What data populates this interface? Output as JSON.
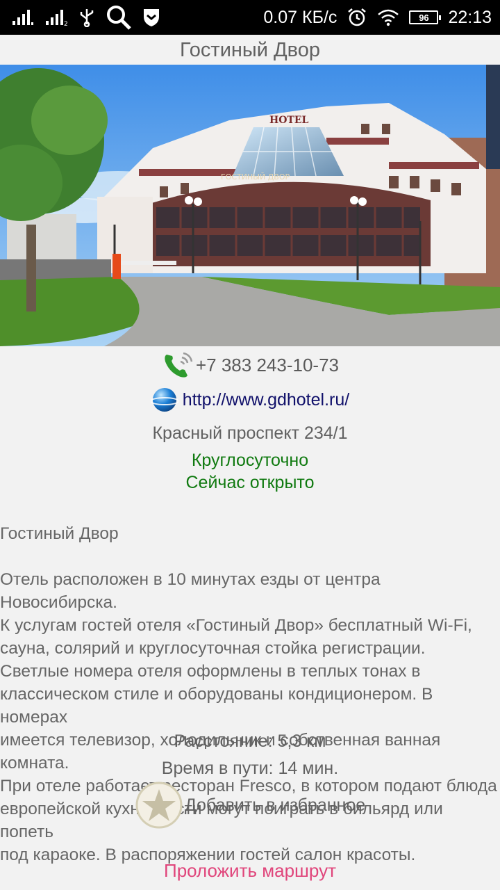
{
  "status_bar": {
    "net_speed": "0.07 КБ/с",
    "battery": "96",
    "time": "22:13",
    "icons": [
      "signal-icon",
      "signal-2-icon",
      "usb-icon",
      "search-icon",
      "shield-icon",
      "alarm-icon",
      "wifi-icon",
      "battery-icon"
    ]
  },
  "header": {
    "title": "Гостиный Двор"
  },
  "photo": {
    "sign_hotel": "HOTEL",
    "sign_name": "ГОСТИНЫЙ ДВОР"
  },
  "contacts": {
    "phone": "+7 383 243-10-73",
    "website": "http://www.gdhotel.ru/",
    "address": "Красный проспект 234/1"
  },
  "hours": {
    "schedule": "Круглосуточно",
    "status": "Сейчас открыто"
  },
  "description": {
    "title": "Гостиный Двор",
    "text": "Отель расположен в 10 минутах езды от центра Новосибирска.\nК услугам гостей отеля «Гостиный Двор» бесплатный Wi-Fi,\nсауна, солярий и круглосуточная стойка регистрации.\nСветлые номера отеля оформлены в теплых тонах в\nклассическом стиле и оборудованы кондиционером. В номерах\nимеется телевизор, холодильник и собственная ванная комната.\nПри отеле работает ресторан Fresco, в котором подают блюда\nевропейской кухни. Гости могут поиграть в бильярд или попеть\nпод караоке. В распоряжении гостей салон красоты."
  },
  "trip": {
    "distance": "Расстояние: 5,3 км",
    "travel_time": "Время в пути: 14 мин."
  },
  "actions": {
    "favorite": "Добавить в избранное",
    "route": "Проложить маршрут"
  },
  "colors": {
    "green_status": "#107a10",
    "route_pink": "#e0457b",
    "link_blue": "#10106a"
  }
}
